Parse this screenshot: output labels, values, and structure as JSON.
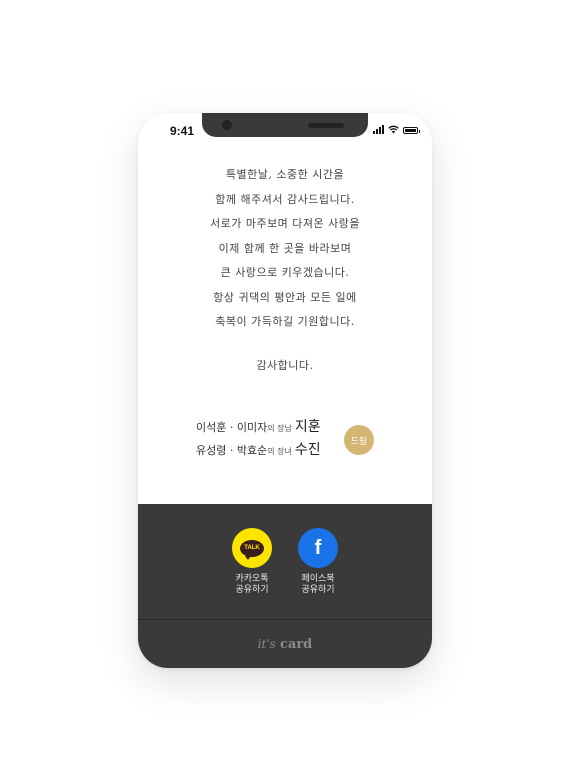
{
  "status_bar": {
    "time": "9:41"
  },
  "message": {
    "lines": [
      "특별한날, 소중한 시간을",
      "함께 해주셔서 감사드립니다.",
      "서로가 마주보며 다져온 사랑을",
      "이제 함께 한 곳을 바라보며",
      "큰 사랑으로 키우겠습니다.",
      "항상 귀댁의 평안과 모든 일에",
      "축복이 가득하길 기원합니다."
    ],
    "thanks": "감사합니다."
  },
  "parents": {
    "groom_line": {
      "parents": "이석훈 · 이미자",
      "relation": "의 장남",
      "name": "지훈"
    },
    "bride_line": {
      "parents": "유성령 · 박효순",
      "relation": "의 장녀",
      "name": "수진"
    }
  },
  "gift_button": {
    "label": "드림",
    "color": "#d4b672"
  },
  "share": {
    "kakao": {
      "icon_text": "TALK",
      "label_line1": "카카오톡",
      "label_line2": "공유하기",
      "color": "#fee500"
    },
    "facebook": {
      "icon_text": "f",
      "label_line1": "페이스북",
      "label_line2": "공유하기",
      "color": "#1a73e8"
    }
  },
  "footer": {
    "logo_its": "it's",
    "logo_card": "card"
  }
}
